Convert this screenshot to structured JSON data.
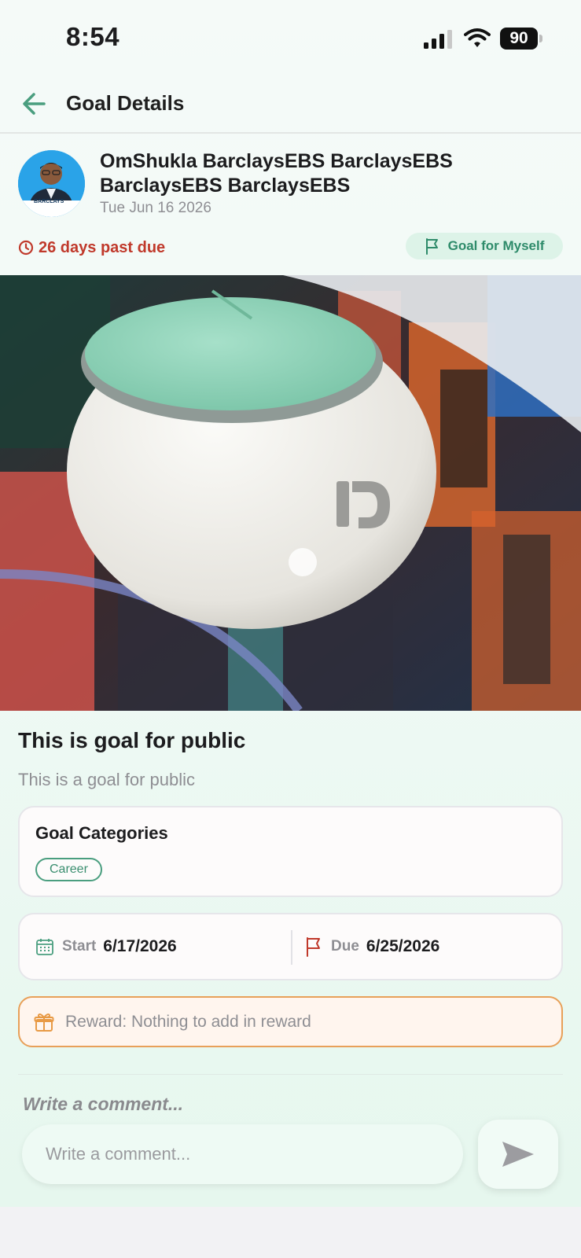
{
  "status_bar": {
    "time": "8:54",
    "battery": "90"
  },
  "header": {
    "title": "Goal Details",
    "back_icon": "arrow-left-icon"
  },
  "author": {
    "name": "OmShukla BarclaysEBS BarclaysEBS BarclaysEBS BarclaysEBS",
    "date": "Tue Jun 16 2026",
    "avatar_logo": "BARCLAYS"
  },
  "status": {
    "past_due": "26 days past due",
    "goal_type": "Goal for Myself"
  },
  "goal": {
    "title": "This is goal for public",
    "description": "This is a goal for public"
  },
  "categories": {
    "title": "Goal Categories",
    "items": [
      "Career"
    ]
  },
  "dates": {
    "start_label": "Start",
    "start_value": "6/17/2026",
    "due_label": "Due",
    "due_value": "6/25/2026"
  },
  "reward": {
    "text": "Reward: Nothing to add in reward"
  },
  "comment": {
    "heading": "Write a comment...",
    "placeholder": "Write a comment..."
  },
  "colors": {
    "accent_green": "#3a8e6f",
    "overdue_red": "#c0392b",
    "reward_orange": "#e8a059"
  }
}
